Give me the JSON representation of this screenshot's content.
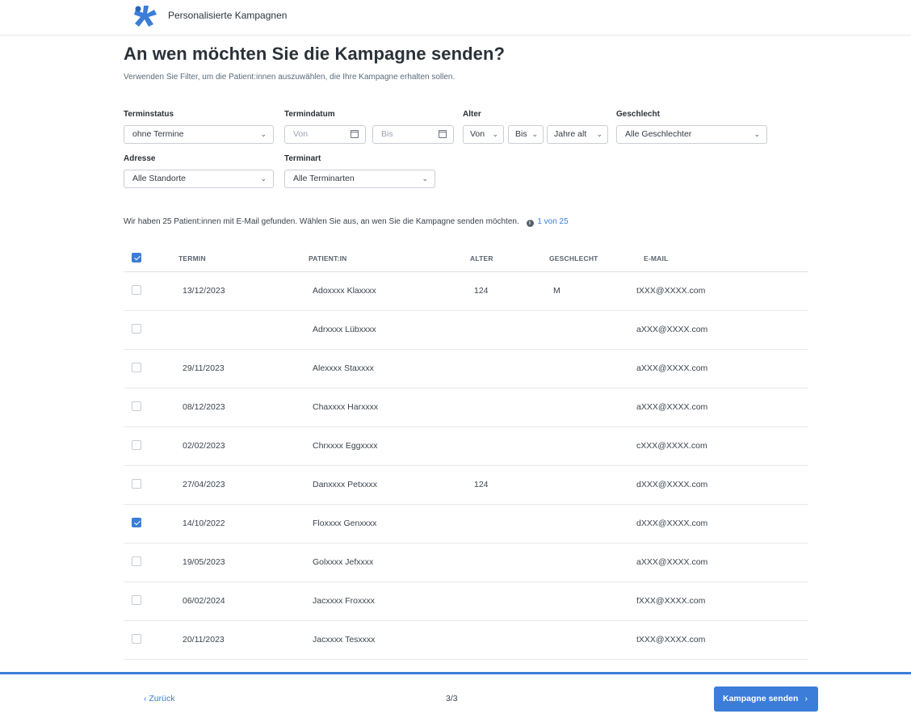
{
  "app": {
    "title": "Personalisierte Kampagnen"
  },
  "page": {
    "title": "An wen möchten Sie die Kampagne senden?",
    "subtitle": "Verwenden Sie Filter, um die Patient:innen auszuwählen, die Ihre Kampagne erhalten sollen."
  },
  "filters": {
    "terminstatus": {
      "label": "Terminstatus",
      "value": "ohne Termine"
    },
    "termindatum": {
      "label": "Termindatum",
      "von_placeholder": "Von",
      "bis_placeholder": "Bis"
    },
    "alter": {
      "label": "Alter",
      "von": "Von",
      "bis": "Bis",
      "unit": "Jahre alt"
    },
    "geschlecht": {
      "label": "Geschlecht",
      "value": "Alle Geschlechter"
    },
    "adresse": {
      "label": "Adresse",
      "value": "Alle Standorte"
    },
    "terminart": {
      "label": "Terminart",
      "value": "Alle Terminarten"
    }
  },
  "results": {
    "text": "Wir haben 25 Patient:innen mit E-Mail gefunden. Wählen Sie aus, an wen Sie die Kampagne senden möchten.",
    "count": "1 von 25"
  },
  "table": {
    "headers": {
      "termin": "TERMIN",
      "patient": "PATIENT:IN",
      "alter": "ALTER",
      "geschlecht": "GESCHLECHT",
      "email": "E-MAIL"
    },
    "header_checked": true,
    "rows": [
      {
        "checked": false,
        "termin": "13/12/2023",
        "patient": "Adoxxxx Klaxxxx",
        "alter": "124",
        "geschlecht": "M",
        "email": "tXXX@XXXX.com"
      },
      {
        "checked": false,
        "termin": "",
        "patient": "Adrxxxx Lübxxxx",
        "alter": "",
        "geschlecht": "",
        "email": "aXXX@XXXX.com"
      },
      {
        "checked": false,
        "termin": "29/11/2023",
        "patient": "Alexxxx Staxxxx",
        "alter": "",
        "geschlecht": "",
        "email": "aXXX@XXXX.com"
      },
      {
        "checked": false,
        "termin": "08/12/2023",
        "patient": "Chaxxxx Harxxxx",
        "alter": "",
        "geschlecht": "",
        "email": "aXXX@XXXX.com"
      },
      {
        "checked": false,
        "termin": "02/02/2023",
        "patient": "Chrxxxx Eggxxxx",
        "alter": "",
        "geschlecht": "",
        "email": "cXXX@XXXX.com"
      },
      {
        "checked": false,
        "termin": "27/04/2023",
        "patient": "Danxxxx Petxxxx",
        "alter": "124",
        "geschlecht": "",
        "email": "dXXX@XXXX.com"
      },
      {
        "checked": true,
        "termin": "14/10/2022",
        "patient": "Floxxxx Genxxxx",
        "alter": "",
        "geschlecht": "",
        "email": "dXXX@XXXX.com"
      },
      {
        "checked": false,
        "termin": "19/05/2023",
        "patient": "Golxxxx Jefxxxx",
        "alter": "",
        "geschlecht": "",
        "email": "aXXX@XXXX.com"
      },
      {
        "checked": false,
        "termin": "06/02/2024",
        "patient": "Jacxxxx Froxxxx",
        "alter": "",
        "geschlecht": "",
        "email": "fXXX@XXXX.com"
      },
      {
        "checked": false,
        "termin": "20/11/2023",
        "patient": "Jacxxxx Tesxxxx",
        "alter": "",
        "geschlecht": "",
        "email": "tXXX@XXXX.com"
      }
    ]
  },
  "footer": {
    "back_label": "‹ Zurück",
    "pager": "3/3",
    "send_label": "Kampagne senden",
    "send_chevron": "›"
  },
  "colors": {
    "accent": "#3b7dd8",
    "logo": "#3b7dd8"
  },
  "icons": [
    "logo-icon",
    "chevron-down-icon",
    "calendar-icon",
    "info-icon",
    "checkbox-icon",
    "arrow-annotation"
  ]
}
